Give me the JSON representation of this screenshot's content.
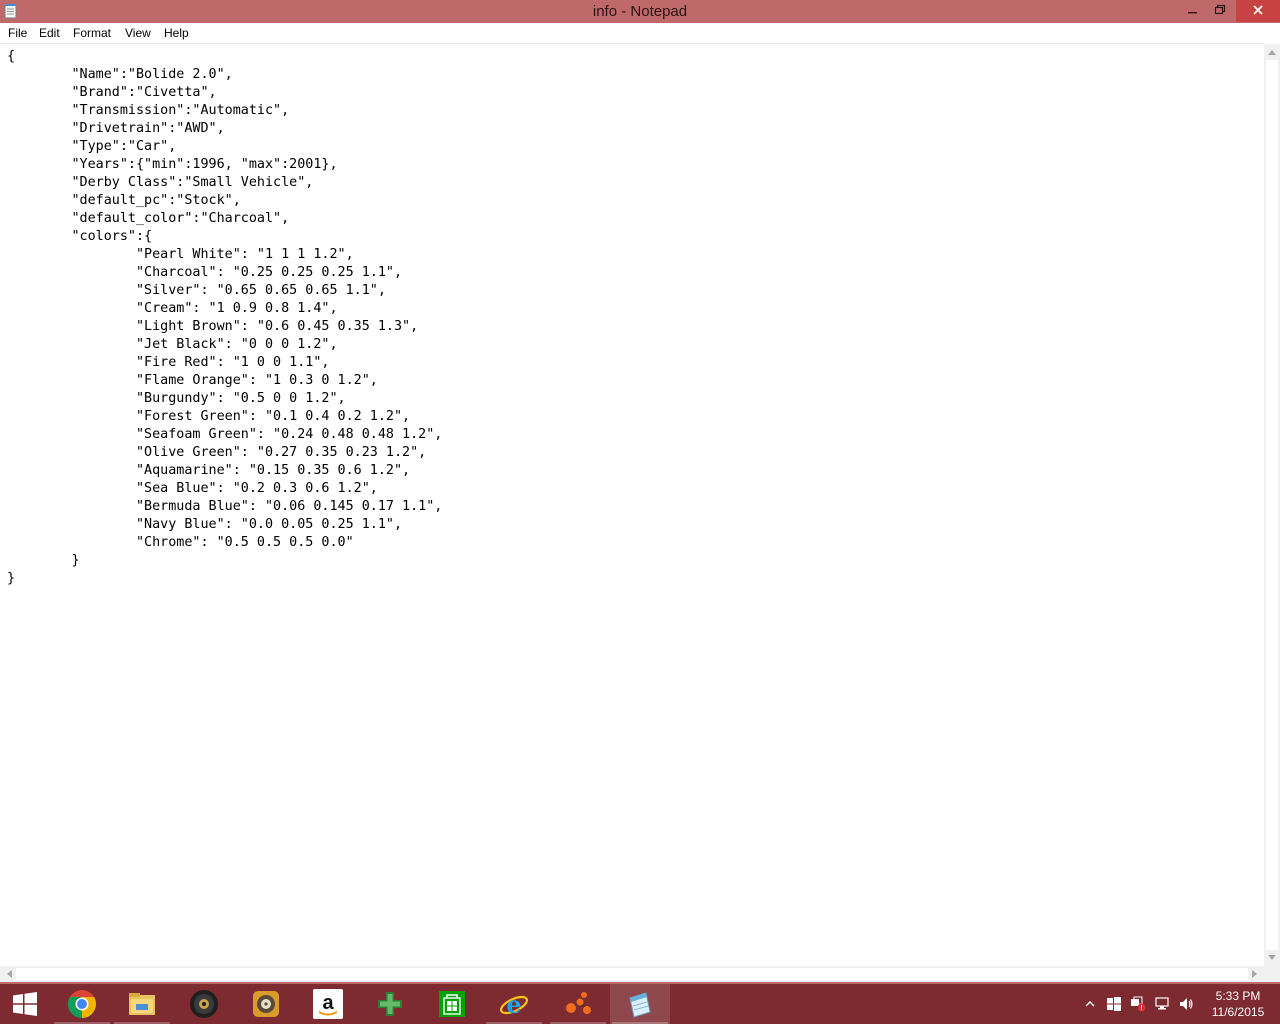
{
  "window": {
    "title": "info - Notepad",
    "icon": "notepad-icon",
    "controls": [
      "minimize-icon",
      "restore-icon",
      "close-icon"
    ]
  },
  "menu": {
    "file": "File",
    "edit": "Edit",
    "format": "Format",
    "view": "View",
    "help": "Help"
  },
  "editor": {
    "content": "{\n\t\"Name\":\"Bolide 2.0\",\n\t\"Brand\":\"Civetta\",\n\t\"Transmission\":\"Automatic\",\n\t\"Drivetrain\":\"AWD\",\n\t\"Type\":\"Car\",\n\t\"Years\":{\"min\":1996, \"max\":2001},\n\t\"Derby Class\":\"Small Vehicle\",\n\t\"default_pc\":\"Stock\",\n\t\"default_color\":\"Charcoal\",\n\t\"colors\":{\n\t\t\"Pearl White\": \"1 1 1 1.2\",\n\t\t\"Charcoal\": \"0.25 0.25 0.25 1.1\",\n\t\t\"Silver\": \"0.65 0.65 0.65 1.1\",\n\t\t\"Cream\": \"1 0.9 0.8 1.4\",\n\t\t\"Light Brown\": \"0.6 0.45 0.35 1.3\",\n\t\t\"Jet Black\": \"0 0 0 1.2\",\n\t\t\"Fire Red\": \"1 0 0 1.1\",\n\t\t\"Flame Orange\": \"1 0.3 0 1.2\",\n\t\t\"Burgundy\": \"0.5 0 0 1.2\",\n\t\t\"Forest Green\": \"0.1 0.4 0.2 1.2\",\n\t\t\"Seafoam Green\": \"0.24 0.48 0.48 1.2\",\n\t\t\"Olive Green\": \"0.27 0.35 0.23 1.2\",\n\t\t\"Aquamarine\": \"0.15 0.35 0.6 1.2\",\n\t\t\"Sea Blue\": \"0.2 0.3 0.6 1.2\",\n\t\t\"Bermuda Blue\": \"0.06 0.145 0.17 1.1\",\n\t\t\"Navy Blue\": \"0.0 0.05 0.25 1.1\",\n\t\t\"Chrome\": \"0.5 0.5 0.5 0.0\"\n\t}\n}"
  },
  "taskbar": {
    "start_icon": "windows-start-icon",
    "apps": [
      {
        "icon": "chrome-icon",
        "running": true
      },
      {
        "icon": "file-explorer-icon",
        "running": true
      },
      {
        "icon": "media-player-icon",
        "running": false
      },
      {
        "icon": "disk-utility-icon",
        "running": false
      },
      {
        "icon": "amazon-icon",
        "running": false
      },
      {
        "icon": "game-icon",
        "running": false
      },
      {
        "icon": "store-icon",
        "running": false
      },
      {
        "icon": "internet-explorer-icon",
        "running": true
      },
      {
        "icon": "molecule-app-icon",
        "running": true
      },
      {
        "icon": "notepad-icon",
        "running": true,
        "active": true
      }
    ],
    "tray": {
      "icons": [
        "show-hidden-icons-chevron",
        "windows-flag-icon",
        "security-alert-icon",
        "network-icon",
        "volume-icon"
      ],
      "time": "5:33 PM",
      "date": "11/6/2015"
    }
  },
  "colors": {
    "title_bar": "#c0696b",
    "close_button": "#c74343",
    "taskbar": "#7d2a30"
  }
}
